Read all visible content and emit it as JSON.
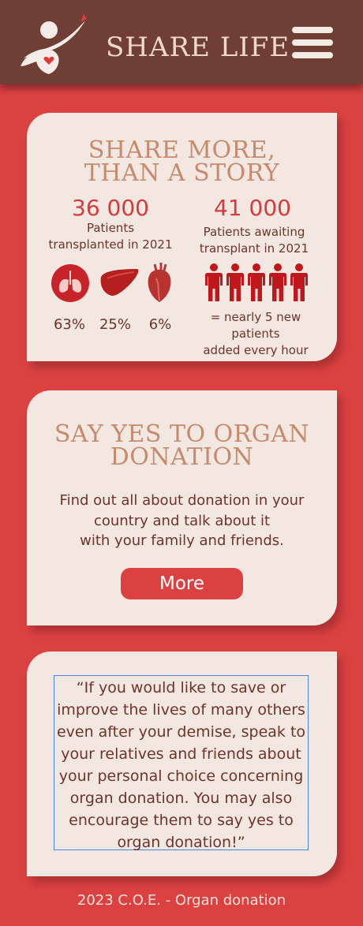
{
  "header": {
    "brand": "SHARE LIFE",
    "logo_icon": "heart-hands-logo-icon",
    "menu_icon": "hamburger-menu-icon"
  },
  "colors": {
    "page_bg": "#dc4142",
    "header_bg": "#6f3f35",
    "card_bg": "#f2e7e1",
    "title": "#c68a6c",
    "accent": "#d33b3e",
    "text": "#6f3329"
  },
  "stats_card": {
    "title_line1": "SHARE MORE,",
    "title_line2": "THAN A STORY",
    "transplanted": {
      "number": "36 000",
      "label_line1": "Patients",
      "label_line2": "transplanted in 2021"
    },
    "awaiting": {
      "number": "41 000",
      "label_line1": "Patients awaiting",
      "label_line2": "transplant in 2021"
    },
    "organs": [
      {
        "icon": "lungs-icon",
        "percent": "63%"
      },
      {
        "icon": "liver-icon",
        "percent": "25%"
      },
      {
        "icon": "heart-icon",
        "percent": "6%"
      }
    ],
    "people_icon": "person-icon",
    "people_count": 5,
    "rate_line1": "= nearly 5 new patients",
    "rate_line2": "added every hour"
  },
  "donation_card": {
    "title_line1": "SAY YES TO ORGAN",
    "title_line2": "DONATION",
    "body_line1": "Find out all about donation in your",
    "body_line2": "country and talk about it",
    "body_line3": "with your family and friends.",
    "button_label": "More"
  },
  "quote_card": {
    "lines": [
      "“If you would like to save or",
      "improve the lives of many others",
      "even after your demise, speak to",
      "your relatives and friends about",
      "your personal choice concerning",
      "organ donation. You may also",
      "encourage them to say yes to",
      "organ donation!”"
    ]
  },
  "footer": {
    "text": "2023 C.O.E. - Organ donation"
  }
}
